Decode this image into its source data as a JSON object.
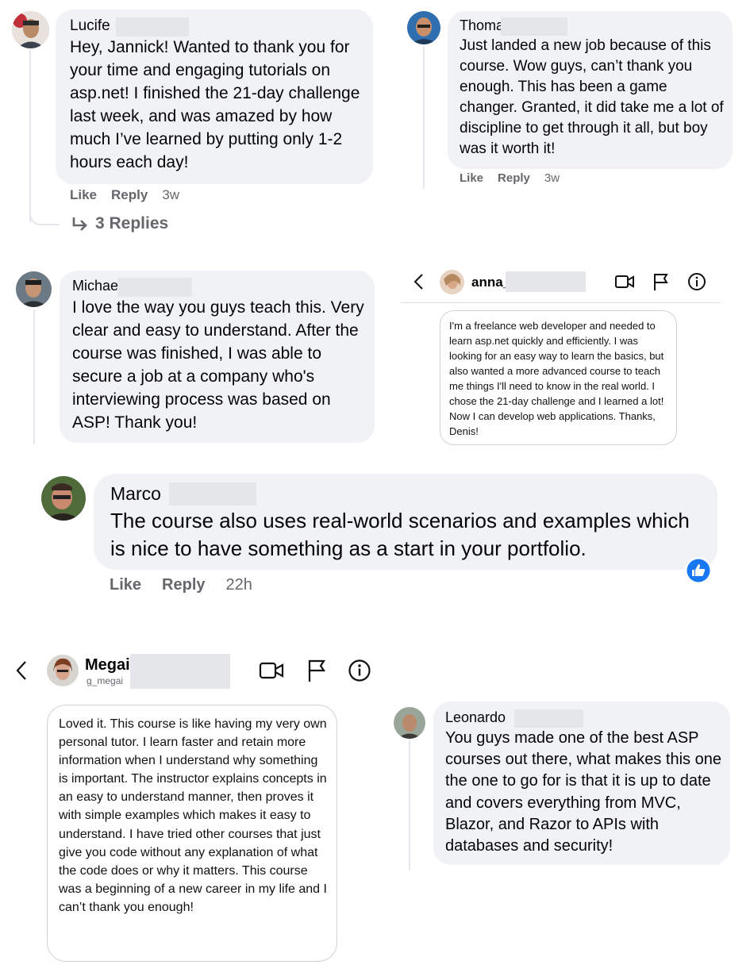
{
  "comments": [
    {
      "name": "Lucife",
      "text": "Hey, Jannick! Wanted to thank you for your time and engaging tutorials on asp.net! I finished the 21-day challenge last week, and was amazed by how much I’ve learned by putting only 1-2 hours each day!",
      "like": "Like",
      "reply": "Reply",
      "time": "3w",
      "replies": "3 Replies"
    },
    {
      "name": "Thoma",
      "text": "Just landed a new job because of this course. Wow guys, can’t thank you enough. This has been a game changer. Granted, it did take me a lot of discipline to get through it all, but boy was it worth it!",
      "like": "Like",
      "reply": "Reply",
      "time": "3w"
    },
    {
      "name": "Michae",
      "text": "I love the way you guys teach this. Very clear and easy to understand. After the course was finished, I was able to secure a job at a company who's interviewing process was based on ASP! Thank you!"
    },
    {
      "name": "Marco",
      "text": "The course also uses real-world scenarios and examples which is nice to have something as a start in your portfolio.",
      "like": "Like",
      "reply": "Reply",
      "time": "22h"
    },
    {
      "name": "Leonardo",
      "text": "You guys made one of the best ASP courses out there, what makes this one the one to go for is that it is up to date and covers everything from MVC, Blazor, and Razor to APIs with databases and security!"
    }
  ],
  "dm_anna": {
    "name": "anna_",
    "text": "I'm a freelance web developer and needed to learn asp.net quickly and efficiently. I was looking for an easy way to learn the basics, but also wanted a more advanced course to teach me things I'll need to know in the real world. I chose the 21-day challenge and I learned a lot! Now I can develop web applications. Thanks, Denis!"
  },
  "dm_megan": {
    "name": "Megai",
    "username": "g_megai",
    "text": "Loved it. This course is like having my very own personal tutor. I learn faster and retain more information when I understand why something is important. The instructor explains concepts in an easy to understand manner, then proves it with simple examples which makes it easy to understand. I have tried other courses that just give you code without any explanation of what the code does or why it matters. This course was a beginning of a new career in my life and I can’t thank you enough!"
  },
  "icons": [
    "back-icon",
    "video-call-icon",
    "flag-icon",
    "info-icon",
    "like-reaction-icon",
    "reply-arrow-icon"
  ],
  "colors": {
    "bubble": "#f0f2f5",
    "meta": "#65676b",
    "like_blue": "#1877f2",
    "redaction": "#e4e6e9"
  }
}
